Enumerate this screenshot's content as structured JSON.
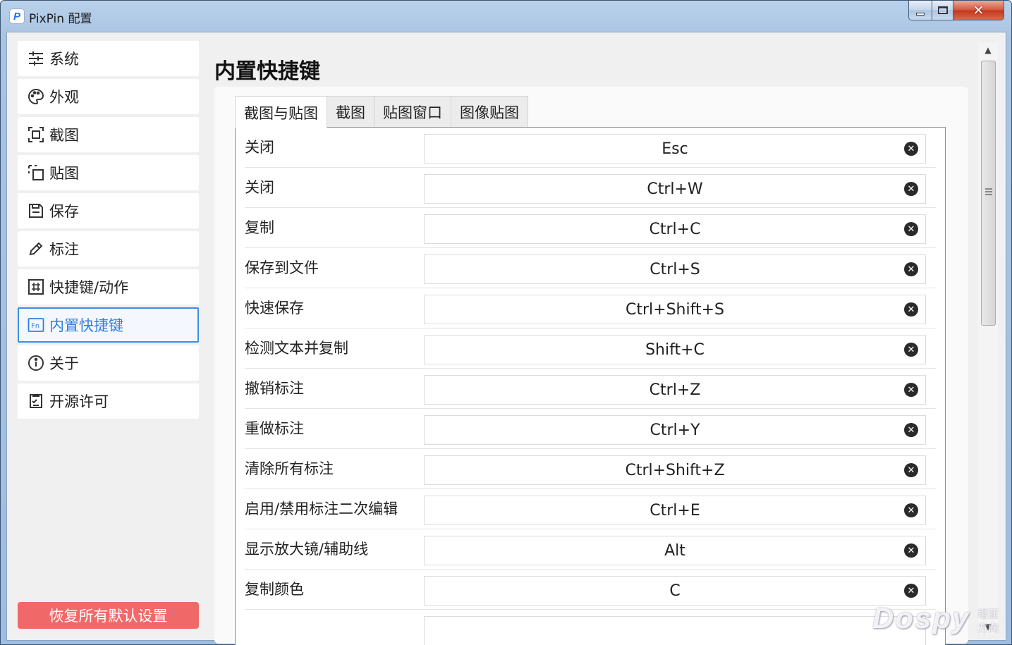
{
  "window": {
    "title": "PixPin 配置",
    "app_icon_letter": "P",
    "minimize_label": "",
    "close_glyph": "✕"
  },
  "sidebar": {
    "items": [
      {
        "label": "系统",
        "icon": "sliders-icon"
      },
      {
        "label": "外观",
        "icon": "palette-icon"
      },
      {
        "label": "截图",
        "icon": "screenshot-icon"
      },
      {
        "label": "贴图",
        "icon": "pin-icon"
      },
      {
        "label": "保存",
        "icon": "save-icon"
      },
      {
        "label": "标注",
        "icon": "pencil-icon"
      },
      {
        "label": "快捷键/动作",
        "icon": "hash-icon"
      },
      {
        "label": "内置快捷键",
        "icon": "fn-icon",
        "active": true
      },
      {
        "label": "关于",
        "icon": "info-icon"
      },
      {
        "label": "开源许可",
        "icon": "checklist-icon"
      }
    ],
    "reset_label": "恢复所有默认设置"
  },
  "main": {
    "page_title": "内置快捷键",
    "tabs": [
      {
        "label": "截图与贴图",
        "active": true
      },
      {
        "label": "截图"
      },
      {
        "label": "贴图窗口"
      },
      {
        "label": "图像贴图"
      }
    ],
    "shortcuts": [
      {
        "action": "关闭",
        "keys": "Esc"
      },
      {
        "action": "关闭",
        "keys": "Ctrl+W"
      },
      {
        "action": "复制",
        "keys": "Ctrl+C"
      },
      {
        "action": "保存到文件",
        "keys": "Ctrl+S"
      },
      {
        "action": "快速保存",
        "keys": "Ctrl+Shift+S"
      },
      {
        "action": "检测文本并复制",
        "keys": "Shift+C"
      },
      {
        "action": "撤销标注",
        "keys": "Ctrl+Z"
      },
      {
        "action": "重做标注",
        "keys": "Ctrl+Y"
      },
      {
        "action": "清除所有标注",
        "keys": "Ctrl+Shift+Z"
      },
      {
        "action": "启用/禁用标注二次编辑",
        "keys": "Ctrl+E"
      },
      {
        "action": "显示放大镜/辅助线",
        "keys": "Alt"
      },
      {
        "action": "复制颜色",
        "keys": "C"
      }
    ]
  },
  "watermark": {
    "text": "Dospy",
    "sub": "塔亚方向"
  },
  "colors": {
    "accent": "#3c8ee6",
    "reset": "#f16868",
    "active_text": "#2f7fe0"
  }
}
